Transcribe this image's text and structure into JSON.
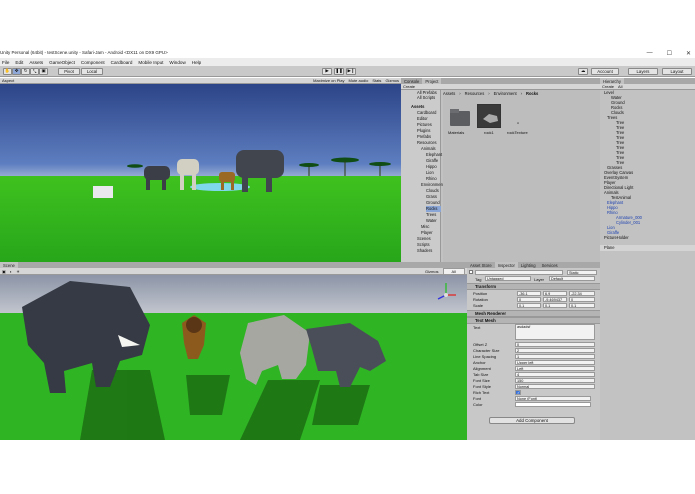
{
  "window": {
    "title": "Unity Personal (64bit) - testScene.unity - Safari-Jam - Android <DX11 on DX9 GPU>",
    "controls": [
      "—",
      "☐",
      "✕"
    ]
  },
  "menu": [
    "File",
    "Edit",
    "Assets",
    "GameObject",
    "Component",
    "Cardboard",
    "Mobile Input",
    "Window",
    "Help"
  ],
  "toolbar": {
    "pivot": "Pivot",
    "local": "Local",
    "account": "Account",
    "layers": "Layers",
    "layout": "Layout"
  },
  "game_view": {
    "aspect": "Aspect",
    "maximize": "Maximize on Play",
    "mute": "Mute audio",
    "stats": "Stats",
    "gizmos": "Gizmos"
  },
  "scene_view": {
    "tab": "Scene",
    "gizmos": "Gizmos",
    "search": "All"
  },
  "project": {
    "tabs": [
      "Console",
      "Project"
    ],
    "create": "Create",
    "favorites": [
      "All Prefabs",
      "All Scripts"
    ],
    "breadcrumb": [
      "Assets",
      "Resources",
      "Environment",
      "Rocks"
    ],
    "tree": [
      "Assets",
      "Cardboard",
      "Editor",
      "Pictures",
      "Plugins",
      "Prefabs",
      "Resources",
      "Animals",
      "Elephant",
      "Giraffe",
      "Hippo",
      "Lion",
      "Rhino",
      "Environment",
      "Clouds",
      "Grass",
      "Ground",
      "Rocks",
      "Trees",
      "Water",
      "Misc",
      "Player",
      "Scenes",
      "Scripts",
      "Shaders"
    ],
    "assets": [
      "Materials",
      "rock1",
      "rockTexture"
    ]
  },
  "hierarchy": {
    "tab": "Hierarchy",
    "create": "Create",
    "search": "All",
    "items": [
      "Level",
      "Water",
      "Ground",
      "Rocks",
      "Clouds",
      "Trees",
      "Tree",
      "Tree",
      "Tree",
      "Tree",
      "Tree",
      "Tree",
      "Tree",
      "Tree",
      "Tree",
      "Grasses",
      "Overlay Canvas",
      "EventSystem",
      "Player",
      "Directional Light",
      "Animals",
      "TestAnimal",
      "Elephant",
      "Hippo",
      "Rhino",
      "Armature_000",
      "Cylinder_001",
      "Lion",
      "Giraffe",
      "PictureHolder",
      "Plane"
    ]
  },
  "inspector": {
    "tabs": [
      "Asset Store",
      "Inspector",
      "Lighting",
      "Services"
    ],
    "object": {
      "tag_label": "Tag",
      "tag": "Untagged",
      "layer_label": "Layer",
      "layer": "Default",
      "static": "Static"
    },
    "transform": {
      "title": "Transform",
      "position": {
        "label": "Position",
        "x": "-36.1",
        "y": "6.9",
        "z": "-22.34"
      },
      "rotation": {
        "label": "Rotation",
        "x": "0",
        "y": "-9.469437",
        "z": "0"
      },
      "scale": {
        "label": "Scale",
        "x": "0.1",
        "y": "0.1",
        "z": "0.1"
      }
    },
    "mesh_renderer": {
      "title": "Mesh Renderer"
    },
    "text_mesh": {
      "title": "Text Mesh",
      "rows": [
        {
          "label": "Text",
          "value": "asdadsf"
        },
        {
          "label": "Offset Z",
          "value": "0"
        },
        {
          "label": "Character Size",
          "value": "2"
        },
        {
          "label": "Line Spacing",
          "value": "1"
        },
        {
          "label": "Anchor",
          "value": "Upper left"
        },
        {
          "label": "Alignment",
          "value": "Left"
        },
        {
          "label": "Tab Size",
          "value": "4"
        },
        {
          "label": "Font Size",
          "value": "150"
        },
        {
          "label": "Font Style",
          "value": "Normal"
        },
        {
          "label": "Rich Text",
          "value": "✓"
        },
        {
          "label": "Font",
          "value": "None (Font)"
        },
        {
          "label": "Color",
          "value": ""
        }
      ]
    },
    "add_component": "Add Component"
  },
  "colors": {
    "accent": "#3a72d8",
    "sky": "#324a8c",
    "grass": "#2bb526"
  }
}
